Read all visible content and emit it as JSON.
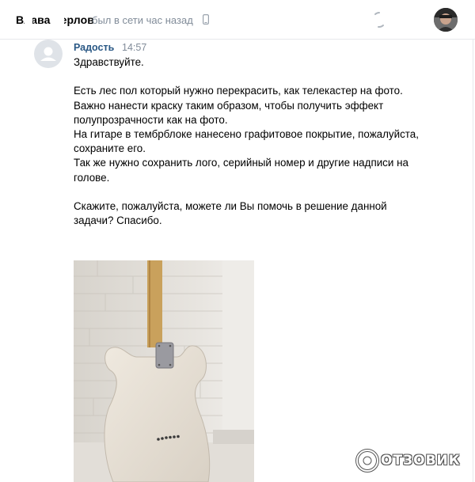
{
  "header": {
    "contact_name": "Влава Рерлов",
    "status": "был в сети час назад"
  },
  "message": {
    "sender": "Радость",
    "time": "14:57",
    "lines": [
      "Здравствуйте.",
      "",
      "Есть лес пол который нужно перекрасить, как телекастер на фото.",
      "Важно нанести краску таким образом, чтобы получить эффект полупрозрачности как на фото.",
      "На гитаре в тембрблоке нанесено графитовое покрытие, пожалуйста, сохраните его.",
      "Так же нужно сохранить лого, серийный номер и другие надписи на голове.",
      "",
      "Скажите, пожалуйста, можете ли Вы помочь в решение данной задачи? Спасибо."
    ]
  },
  "watermark": {
    "text": "ОТЗОВИК"
  }
}
